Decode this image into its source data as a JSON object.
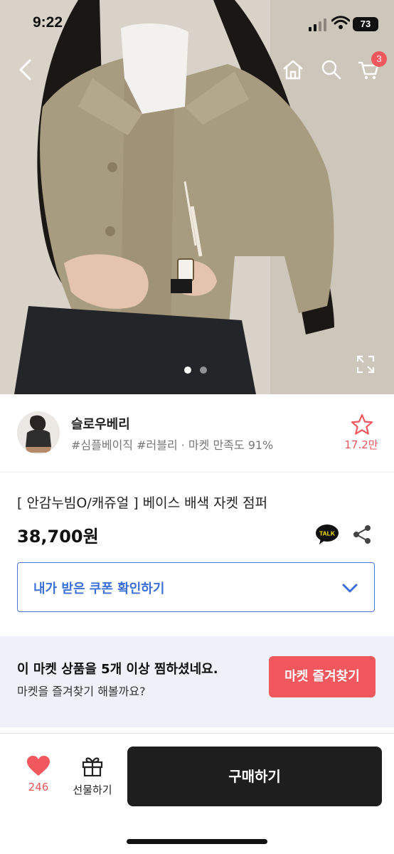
{
  "status_bar": {
    "time": "9:22",
    "battery": "73"
  },
  "nav": {
    "cart_count": "3"
  },
  "carousel": {
    "total": 2,
    "active": 1
  },
  "shop": {
    "name": "슬로우베리",
    "tags": "#심플베이직 #러블리 · 마켓 만족도 91%",
    "favorites": "17.2만"
  },
  "product": {
    "title": "[ 안감누빔O/캐쥬얼 ] 베이스 배색 자켓 점퍼",
    "price": "38,700원",
    "talk_label": "TALK"
  },
  "coupon": {
    "label": "내가 받은 쿠폰 확인하기"
  },
  "banner": {
    "title": "이 마켓 상품을 5개 이상 찜하셨네요.",
    "subtitle": "마켓을 즐겨찾기 해볼까요?",
    "button": "마켓 즐겨찾기"
  },
  "bottom_bar": {
    "like_count": "246",
    "gift_label": "선물하기",
    "buy_label": "구매하기"
  },
  "colors": {
    "accent": "#f0585e",
    "coupon_blue": "#3c6fd6",
    "buy_bg": "#1e1e1e",
    "banner_bg": "#eef2f8"
  }
}
